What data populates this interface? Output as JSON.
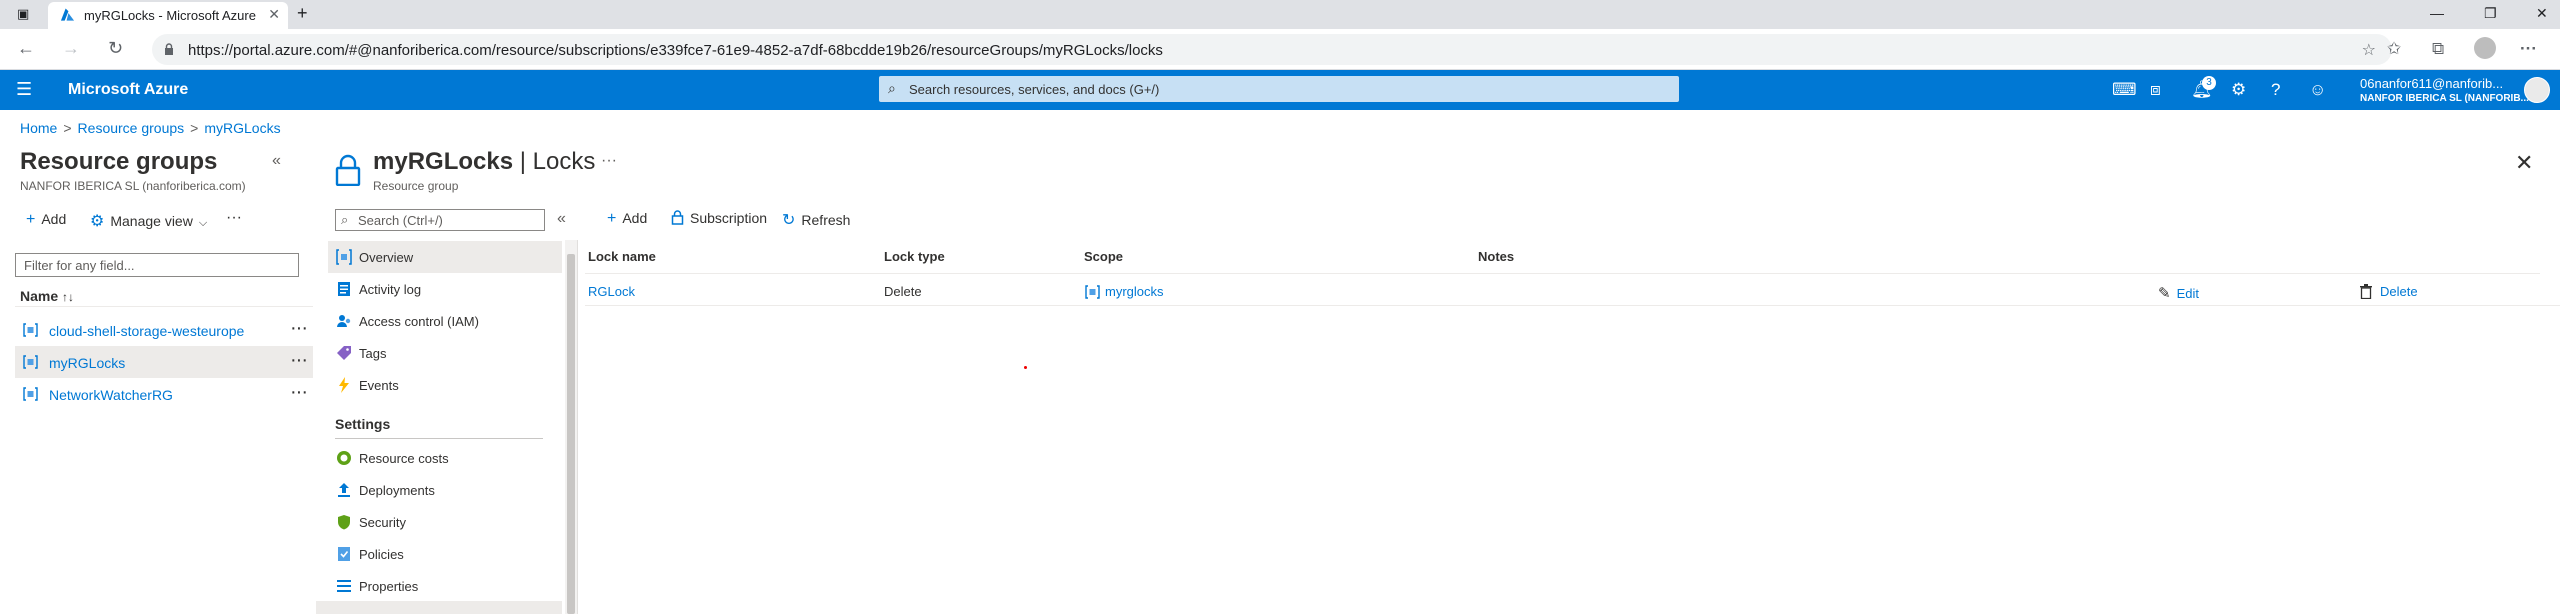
{
  "browser": {
    "tab_title": "myRGLocks - Microsoft Azure",
    "new_tab_glyph": "+",
    "url": "https://portal.azure.com/#@nanforiberica.com/resource/subscriptions/e339fce7-61e9-4852-a7df-68bcdde19b26/resourceGroups/myRGLocks/locks"
  },
  "azure": {
    "brand": "Microsoft Azure",
    "search_placeholder": "Search resources, services, and docs (G+/)",
    "notification_count": "3",
    "account_email": "06nanfor611@nanforib...",
    "account_org": "NANFOR IBERICA SL (NANFORIB...",
    "accent_color": "#0078d4"
  },
  "breadcrumb": {
    "home": "Home",
    "resource_groups": "Resource groups",
    "current": "myRGLocks",
    "separator": ">"
  },
  "left_pane": {
    "title": "Resource groups",
    "subtitle": "NANFOR IBERICA SL (nanforiberica.com)",
    "add": "Add",
    "manage_view": "Manage view",
    "filter_placeholder": "Filter for any field...",
    "name_header": "Name",
    "items": [
      {
        "name": "cloud-shell-storage-westeurope"
      },
      {
        "name": "myRGLocks"
      },
      {
        "name": "NetworkWatcherRG"
      }
    ]
  },
  "blade": {
    "title_resource": "myRGLocks",
    "title_section": "| Locks",
    "subtitle": "Resource group",
    "search_placeholder": "Search (Ctrl+/)"
  },
  "menu": {
    "items": [
      {
        "label": "Overview",
        "icon": "overview-icon"
      },
      {
        "label": "Activity log",
        "icon": "activity-log-icon"
      },
      {
        "label": "Access control (IAM)",
        "icon": "iam-icon"
      },
      {
        "label": "Tags",
        "icon": "tag-icon"
      },
      {
        "label": "Events",
        "icon": "lightning-icon"
      }
    ],
    "settings_header": "Settings",
    "settings_items": [
      {
        "label": "Resource costs",
        "icon": "cost-icon"
      },
      {
        "label": "Deployments",
        "icon": "deployments-icon"
      },
      {
        "label": "Security",
        "icon": "shield-icon"
      },
      {
        "label": "Policies",
        "icon": "policy-icon"
      },
      {
        "label": "Properties",
        "icon": "properties-icon"
      }
    ]
  },
  "content": {
    "commands": {
      "add": "Add",
      "subscription": "Subscription",
      "refresh": "Refresh"
    },
    "columns": {
      "lock_name": "Lock name",
      "lock_type": "Lock type",
      "scope": "Scope",
      "notes": "Notes"
    },
    "rows": [
      {
        "lock_name": "RGLock",
        "lock_type": "Delete",
        "scope": "myrglocks",
        "notes": "",
        "edit": "Edit",
        "delete": "Delete"
      }
    ]
  }
}
